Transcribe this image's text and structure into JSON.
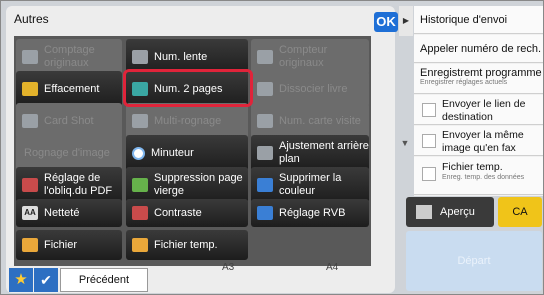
{
  "panel": {
    "title": "Autres",
    "ok_label": "OK"
  },
  "tiles": {
    "r1": [
      "Comptage originaux",
      "Num. lente",
      "Compteur originaux"
    ],
    "r2": [
      "Effacement",
      "Num. 2 pages",
      "Dissocier livre"
    ],
    "r3": [
      "Card Shot",
      "Multi-rognage",
      "Num. carte visite"
    ],
    "r4": [
      "Rognage d'image",
      "Minuteur",
      "Ajustement arrière plan"
    ],
    "r5": [
      "Réglage de l'obliq.du PDF",
      "Suppression page vierge",
      "Supprimer la couleur"
    ],
    "r6": [
      "Netteté",
      "Contraste",
      "Réglage RVB"
    ],
    "r7": [
      "Fichier",
      "Fichier temp."
    ]
  },
  "bottom": {
    "star": "★",
    "check": "✔",
    "prev_label": "Précédent",
    "size_a3": "A3",
    "size_a4": "A4"
  },
  "right": {
    "collapse": "▶",
    "history": "Historique d'envoi",
    "recall": "Appeler numéro de rech.",
    "save_prog": "Enregistremt programme",
    "save_prog_sub": "Enregistrer réglages actuels",
    "send_link": "Envoyer le lien de destination",
    "send_same": "Envoyer la même image qu'en fax",
    "temp_file": "Fichier temp.",
    "temp_file_sub": "Enreg. temp. des données",
    "scroll": "▼"
  },
  "actions": {
    "preview": "Aperçu",
    "ca": "CA",
    "start": "Départ"
  }
}
